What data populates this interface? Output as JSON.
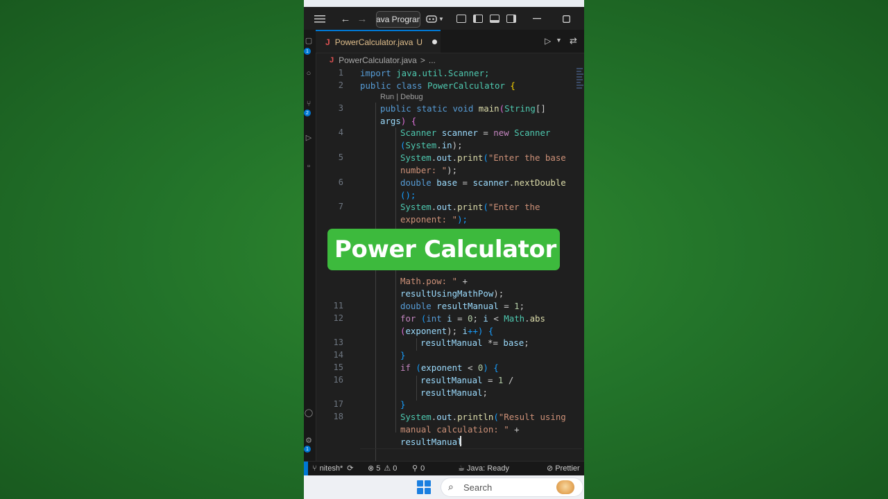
{
  "titlebar": {
    "command_center": "ava Program"
  },
  "tab": {
    "filename": "PowerCalculator.java",
    "status": "U"
  },
  "breadcrumb": {
    "file": "PowerCalculator.java",
    "separator": ">",
    "rest": "..."
  },
  "activity_badges": [
    "1",
    "2",
    "1"
  ],
  "code_lens": "Run | Debug",
  "line_numbers": [
    "1",
    "2",
    "3",
    "4",
    "5",
    "6",
    "7",
    "11",
    "12",
    "13",
    "14",
    "15",
    "16",
    "17",
    "18"
  ],
  "code": {
    "l1": [
      "import",
      " java.util.Scanner;"
    ],
    "l2": [
      "public",
      " ",
      "class",
      " ",
      "PowerCalculator",
      " {"
    ],
    "l3a": [
      "public",
      " ",
      "static",
      " ",
      "void",
      " ",
      "main",
      "(",
      "String",
      "[]"
    ],
    "l3b": [
      "args",
      ") {"
    ],
    "l4a": [
      "Scanner",
      " ",
      "scanner",
      " = ",
      "new",
      " ",
      "Scanner"
    ],
    "l4b": [
      "(",
      "System",
      ".",
      "in",
      ");"
    ],
    "l5a": [
      "System",
      ".",
      "out",
      ".",
      "print",
      "(",
      "\"Enter the base"
    ],
    "l5b": [
      "number: \"",
      ");"
    ],
    "l6a": [
      "double",
      " ",
      "base",
      " = ",
      "scanner",
      ".",
      "nextDouble"
    ],
    "l6b": [
      "();"
    ],
    "l7a": [
      "System",
      ".",
      "out",
      ".",
      "print",
      "(",
      "\"Enter the"
    ],
    "l7b": [
      "exponent: \"",
      ");"
    ],
    "l10b": [
      "Math.pow: \"",
      " +"
    ],
    "l10c": [
      "resultUsingMathPow",
      ");"
    ],
    "l11": [
      "double",
      " ",
      "resultManual",
      " = ",
      "1",
      ";"
    ],
    "l12a": [
      "for",
      " (",
      "int",
      " ",
      "i",
      " = ",
      "0",
      "; ",
      "i",
      " < ",
      "Math",
      ".",
      "abs"
    ],
    "l12b": [
      "(",
      "exponent",
      "); ",
      "i",
      "++) {"
    ],
    "l13": [
      "resultManual",
      " *= ",
      "base",
      ";"
    ],
    "l14": [
      "}"
    ],
    "l15": [
      "if",
      " (",
      "exponent",
      " < ",
      "0",
      ") {"
    ],
    "l16a": [
      "resultManual",
      " = ",
      "1",
      " /"
    ],
    "l16b": [
      "resultManual",
      ";"
    ],
    "l17": [
      "}"
    ],
    "l18a": [
      "System",
      ".",
      "out",
      ".",
      "println",
      "(",
      "\"Result using"
    ],
    "l18b": [
      "manual calculation: \"",
      " +"
    ],
    "l18c": [
      "resultManual"
    ]
  },
  "overlay": {
    "title": "Power Calculator"
  },
  "statusbar": {
    "branch": "nitesh*",
    "errors": "5",
    "warnings": "0",
    "ports": "0",
    "java_status": "Java: Ready",
    "prettier": "Prettier"
  },
  "taskbar": {
    "search_placeholder": "Search"
  },
  "colors": {
    "background_green": "#23742a",
    "banner_green": "#3dba3d",
    "editor_bg": "#1f1f1f",
    "accent_blue": "#0078d4",
    "modified_file": "#e2c08d"
  }
}
